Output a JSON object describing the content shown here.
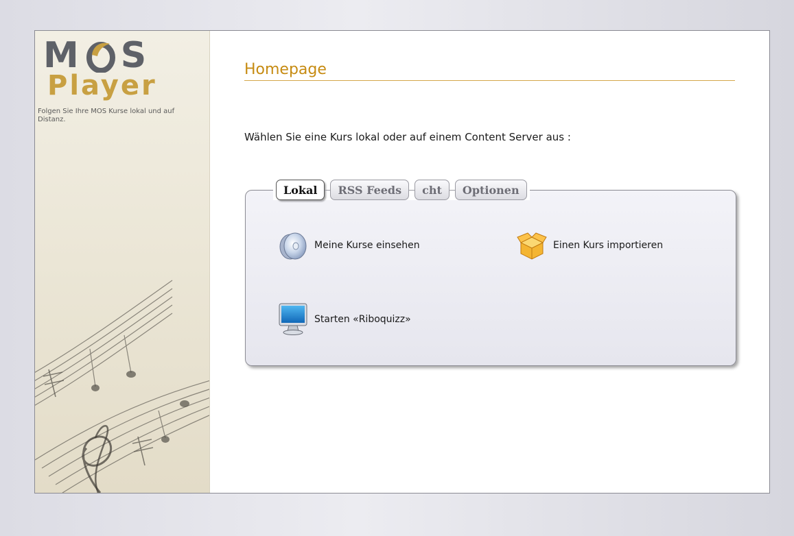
{
  "app": {
    "logo_line1_left": "M",
    "logo_line1_right": "S",
    "logo_line2": "Player",
    "tagline": "Folgen Sie Ihre MOS Kurse lokal und auf Distanz."
  },
  "page": {
    "title": "Homepage",
    "intro": "Wählen Sie eine Kurs lokal oder auf einem Content Server aus :"
  },
  "tabs": [
    {
      "label": "Lokal",
      "active": true
    },
    {
      "label": "RSS Feeds",
      "active": false
    },
    {
      "label": "cht",
      "active": false
    },
    {
      "label": "Optionen",
      "active": false
    }
  ],
  "actions": {
    "view_courses": {
      "label": "Meine Kurse einsehen",
      "icon": "cd-discs-icon"
    },
    "import_course": {
      "label": "Einen Kurs importieren",
      "icon": "open-box-icon"
    },
    "start_quiz": {
      "label": "Starten «Riboquizz»",
      "icon": "monitor-icon"
    }
  },
  "colors": {
    "accent": "#c68b12",
    "logo_gray": "#5e6168",
    "logo_gold": "#c8a042"
  }
}
